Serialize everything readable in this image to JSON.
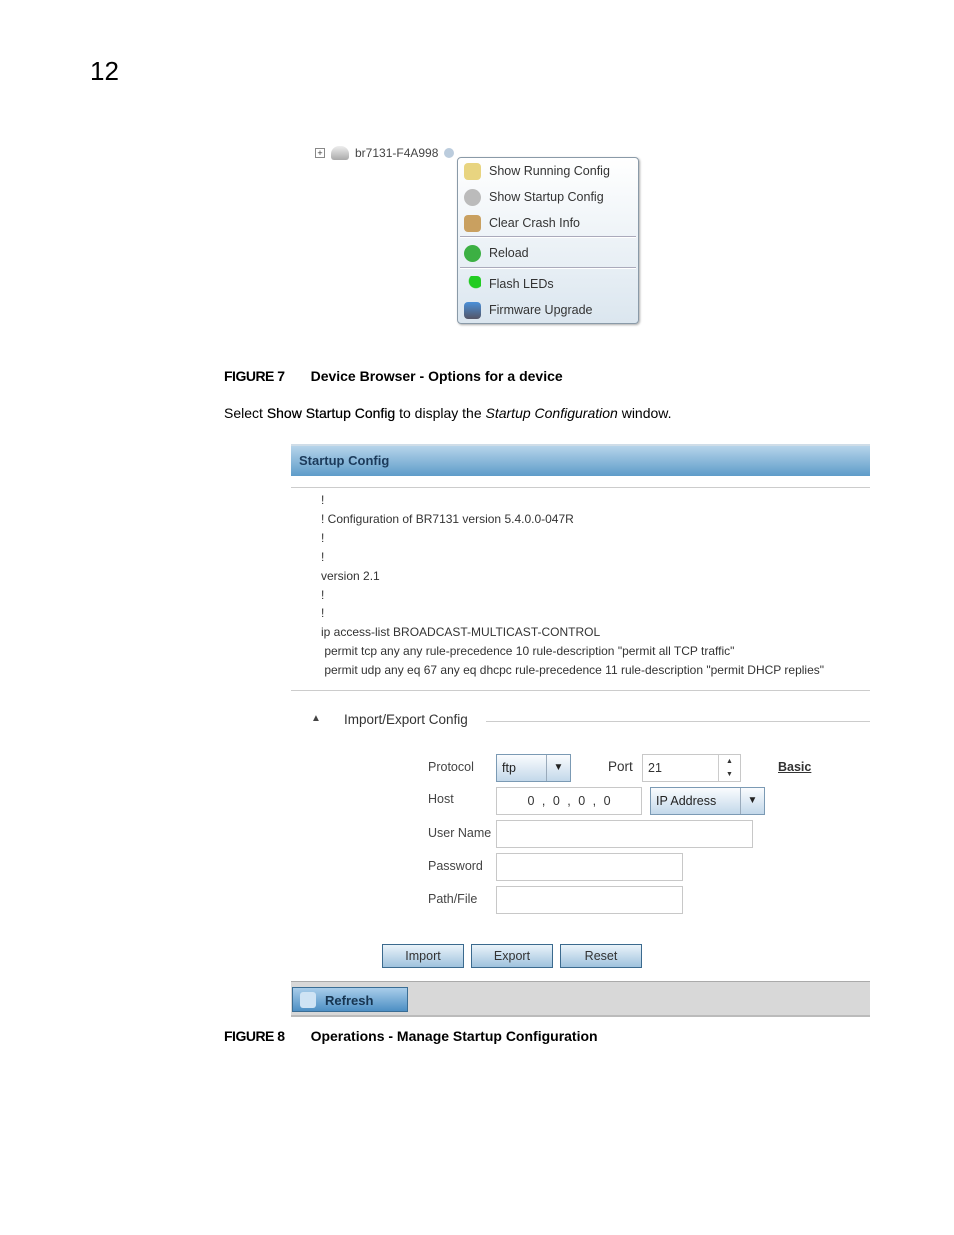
{
  "chapter": "12",
  "figure7": {
    "device": "br7131-F4A998",
    "menu": [
      {
        "label": "Show Running Config",
        "icon": "document-icon"
      },
      {
        "label": "Show Startup Config",
        "icon": "gear-icon"
      },
      {
        "label": "Clear Crash Info",
        "icon": "broom-icon"
      },
      {
        "label": "Reload",
        "icon": "reload-icon"
      },
      {
        "label": "Flash LEDs",
        "icon": "led-icon"
      },
      {
        "label": "Firmware Upgrade",
        "icon": "firmware-icon"
      }
    ],
    "caption_num": "FIGURE 7",
    "caption": "Device Browser - Options for a device"
  },
  "body": {
    "pre": "Select ",
    "bold": "Show Startup Config",
    "mid": " to display the ",
    "italic": "Startup Configuration",
    "post": " window."
  },
  "figure8": {
    "title": "Startup Config",
    "config_lines": [
      "!",
      "! Configuration of BR7131 version 5.4.0.0-047R",
      "!",
      "!",
      "version 2.1",
      "!",
      "!",
      "ip access-list BROADCAST-MULTICAST-CONTROL",
      " permit tcp any any rule-precedence 10 rule-description \"permit all TCP traffic\"",
      " permit udp any eq 67 any eq dhcpc rule-precedence 11 rule-description \"permit DHCP replies\""
    ],
    "section": "Import/Export Config",
    "protocol_label": "Protocol",
    "protocol": "ftp",
    "port_label": "Port",
    "port": "21",
    "basic": "Basic",
    "host_label": "Host",
    "host": [
      "0",
      "0",
      "0",
      "0"
    ],
    "host_type": "IP Address",
    "username_label": "User Name",
    "password_label": "Password",
    "path_label": "Path/File",
    "import": "Import",
    "export": "Export",
    "reset": "Reset",
    "refresh": "Refresh",
    "caption_num": "FIGURE 8",
    "caption": "Operations - Manage Startup Configuration"
  },
  "colors": {
    "header": "#5e9cc9",
    "button": "#9fc2dd"
  }
}
